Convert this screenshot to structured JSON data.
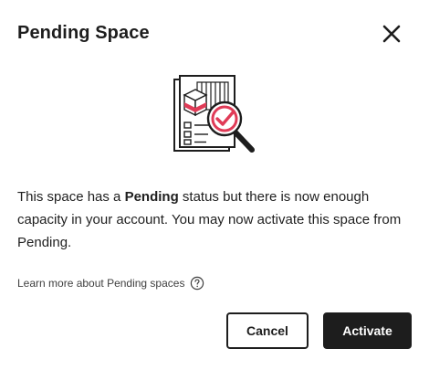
{
  "dialog": {
    "title": "Pending Space",
    "close_icon": "close-icon",
    "illustration_icon": "pending-space-illustration"
  },
  "message": {
    "part1": "This space has a ",
    "bold": "Pending",
    "part2": " status but there is now enough capacity in your account. You may now activate this space from Pending."
  },
  "learn_more": {
    "label": "Learn more about Pending spaces",
    "icon": "help-circle-icon"
  },
  "actions": {
    "cancel_label": "Cancel",
    "activate_label": "Activate"
  },
  "colors": {
    "accent_red": "#e03b57",
    "dark": "#1d1d1d",
    "background": "#ffffff"
  }
}
